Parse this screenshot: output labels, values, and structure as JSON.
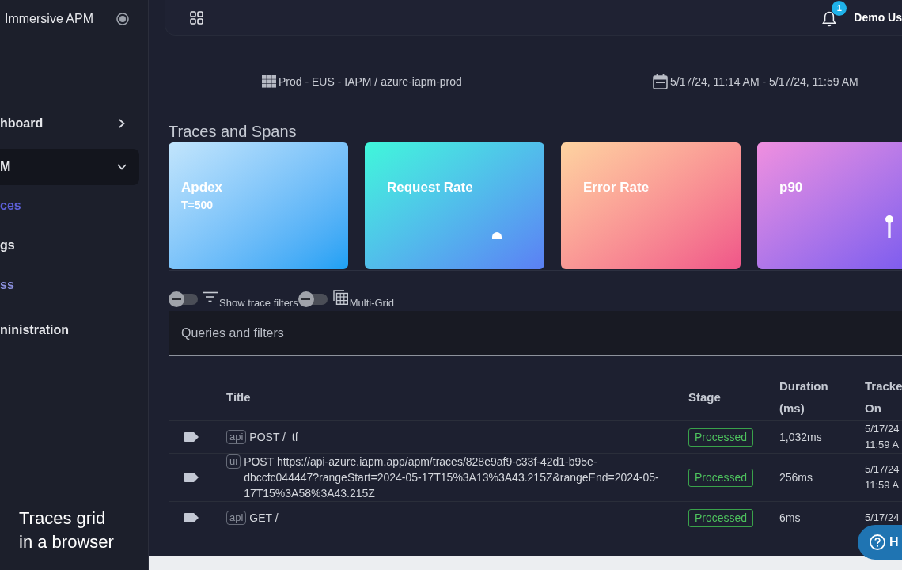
{
  "sidebar": {
    "brand": "Immersive APM",
    "items": [
      {
        "kind": "group",
        "label": "hboard",
        "expanded": false
      },
      {
        "kind": "group",
        "label": "M",
        "expanded": true,
        "children": [
          {
            "label": "ces",
            "selected": true,
            "hovered": false
          },
          {
            "label": "gs",
            "selected": false,
            "hovered": false
          },
          {
            "label": "ss",
            "selected": false,
            "hovered": true
          }
        ]
      },
      {
        "kind": "link",
        "label": "ninistration",
        "selected": false
      }
    ]
  },
  "top_bar": {
    "notifications": "1",
    "user": "Demo Us"
  },
  "context": {
    "environment": "Prod - EUS - IAPM / azure-iapm-prod",
    "time_range": "5/17/24, 11:14 AM - 5/17/24, 11:59 AM"
  },
  "section_title": "Traces and Spans",
  "cards": [
    {
      "kind": "plain",
      "title": "Apdex",
      "subtitle": "T=500"
    },
    {
      "kind": "dome",
      "title": "Request Rate"
    },
    {
      "kind": "plain",
      "title": "Error Rate"
    },
    {
      "kind": "pin",
      "title": "p90"
    }
  ],
  "toolbar": {
    "toggles": [
      {
        "kind": "filter",
        "label": "Show trace filters",
        "on": false
      },
      {
        "kind": "grid",
        "label": "Multi-Grid",
        "on": false
      }
    ]
  },
  "queries_panel": {
    "title": "Queries and filters"
  },
  "table": {
    "columns": [
      {
        "lines": [
          "Title"
        ]
      },
      {
        "lines": [
          "Stage"
        ]
      },
      {
        "lines": [
          "Duration",
          "(ms)"
        ]
      },
      {
        "lines": [
          "Tracke",
          "On"
        ]
      }
    ],
    "rows": [
      {
        "source": "api",
        "title": "POST /_tf",
        "stage": "Processed",
        "duration": "1,032ms",
        "tracked_on": [
          "5/17/24",
          "11:59 A"
        ]
      },
      {
        "source": "ui",
        "title": "POST https://api-azure.iapm.app/apm/traces/828e9af9-c33f-42d1-b95e-dbccfc044447?rangeStart=2024-05-17T15%3A13%3A43.215Z&rangeEnd=2024-05-17T15%3A58%3A43.215Z",
        "stage": "Processed",
        "duration": "256ms",
        "tracked_on": [
          "5/17/24",
          "11:59 A"
        ]
      },
      {
        "source": "api",
        "title": "GET /",
        "stage": "Processed",
        "duration": "6ms",
        "tracked_on": [
          "5/17/24"
        ]
      }
    ]
  },
  "help_button": {
    "label": "H"
  },
  "caption": {
    "lines": [
      "Traces grid",
      "in a browser"
    ]
  }
}
